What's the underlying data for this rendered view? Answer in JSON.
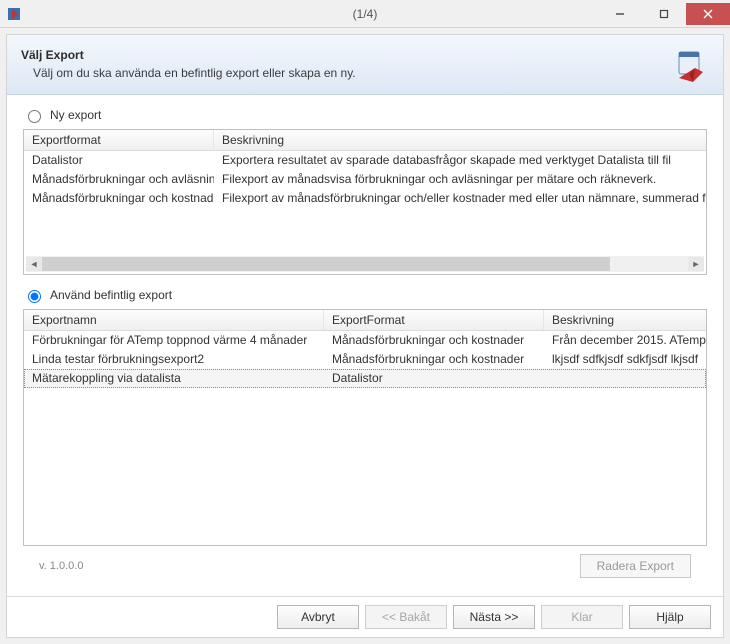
{
  "window": {
    "title": "(1/4)"
  },
  "header": {
    "title": "Välj Export",
    "subtitle": "Välj om du ska använda en befintlig export eller skapa en ny."
  },
  "options": {
    "new_export_label": "Ny export",
    "use_existing_label": "Använd befintlig export"
  },
  "formats_table": {
    "columns": {
      "format": "Exportformat",
      "desc": "Beskrivning"
    },
    "rows": [
      {
        "format": "Datalistor",
        "desc": "Exportera resultatet av sparade databasfrågor skapade med verktyget Datalista till fil"
      },
      {
        "format": "Månadsförbrukningar och avläsningar",
        "desc": "Filexport av månadsvisa förbrukningar och avläsningar per mätare och räkneverk."
      },
      {
        "format": "Månadsförbrukningar och kostnader",
        "desc": "Filexport av månadsförbrukningar och/eller kostnader med eller utan nämnare, summerad för vald tr"
      }
    ]
  },
  "exports_table": {
    "columns": {
      "name": "Exportnamn",
      "format": "ExportFormat",
      "desc": "Beskrivning"
    },
    "rows": [
      {
        "name": "Förbrukningar för ATemp  toppnod värme 4 månader",
        "format": "Månadsförbrukningar och kostnader",
        "desc": "Från december 2015. ATemp"
      },
      {
        "name": "Linda testar förbrukningsexport2",
        "format": "Månadsförbrukningar och kostnader",
        "desc": "lkjsdf sdfkjsdf sdkfjsdf lkjsdf"
      },
      {
        "name": "Mätarekoppling via datalista",
        "format": "Datalistor",
        "desc": ""
      }
    ],
    "selected_index": 2
  },
  "version": "v.  1.0.0.0",
  "buttons": {
    "delete_export": "Radera Export",
    "cancel": "Avbryt",
    "back": "<< Bakåt",
    "next": "Nästa >>",
    "finish": "Klar",
    "help": "Hjälp"
  }
}
